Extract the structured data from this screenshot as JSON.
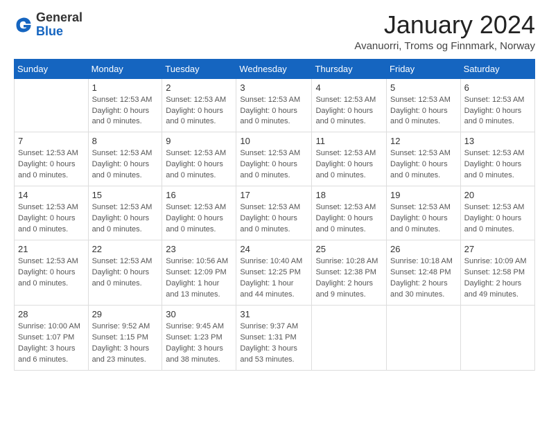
{
  "header": {
    "logo": {
      "line1": "General",
      "line2": "Blue"
    },
    "title": "January 2024",
    "subtitle": "Avanuorri, Troms og Finnmark, Norway"
  },
  "calendar": {
    "days_of_week": [
      "Sunday",
      "Monday",
      "Tuesday",
      "Wednesday",
      "Thursday",
      "Friday",
      "Saturday"
    ],
    "weeks": [
      {
        "cells": [
          {
            "day": "",
            "info": ""
          },
          {
            "day": "1",
            "info": "Sunset: 12:53 AM\nDaylight: 0 hours and 0 minutes."
          },
          {
            "day": "2",
            "info": "Sunset: 12:53 AM\nDaylight: 0 hours and 0 minutes."
          },
          {
            "day": "3",
            "info": "Sunset: 12:53 AM\nDaylight: 0 hours and 0 minutes."
          },
          {
            "day": "4",
            "info": "Sunset: 12:53 AM\nDaylight: 0 hours and 0 minutes."
          },
          {
            "day": "5",
            "info": "Sunset: 12:53 AM\nDaylight: 0 hours and 0 minutes."
          },
          {
            "day": "6",
            "info": "Sunset: 12:53 AM\nDaylight: 0 hours and 0 minutes."
          }
        ]
      },
      {
        "cells": [
          {
            "day": "7",
            "info": "Sunset: 12:53 AM\nDaylight: 0 hours and 0 minutes."
          },
          {
            "day": "8",
            "info": "Sunset: 12:53 AM\nDaylight: 0 hours and 0 minutes."
          },
          {
            "day": "9",
            "info": "Sunset: 12:53 AM\nDaylight: 0 hours and 0 minutes."
          },
          {
            "day": "10",
            "info": "Sunset: 12:53 AM\nDaylight: 0 hours and 0 minutes."
          },
          {
            "day": "11",
            "info": "Sunset: 12:53 AM\nDaylight: 0 hours and 0 minutes."
          },
          {
            "day": "12",
            "info": "Sunset: 12:53 AM\nDaylight: 0 hours and 0 minutes."
          },
          {
            "day": "13",
            "info": "Sunset: 12:53 AM\nDaylight: 0 hours and 0 minutes."
          }
        ]
      },
      {
        "cells": [
          {
            "day": "14",
            "info": "Sunset: 12:53 AM\nDaylight: 0 hours and 0 minutes."
          },
          {
            "day": "15",
            "info": "Sunset: 12:53 AM\nDaylight: 0 hours and 0 minutes."
          },
          {
            "day": "16",
            "info": "Sunset: 12:53 AM\nDaylight: 0 hours and 0 minutes."
          },
          {
            "day": "17",
            "info": "Sunset: 12:53 AM\nDaylight: 0 hours and 0 minutes."
          },
          {
            "day": "18",
            "info": "Sunset: 12:53 AM\nDaylight: 0 hours and 0 minutes."
          },
          {
            "day": "19",
            "info": "Sunset: 12:53 AM\nDaylight: 0 hours and 0 minutes."
          },
          {
            "day": "20",
            "info": "Sunset: 12:53 AM\nDaylight: 0 hours and 0 minutes."
          }
        ]
      },
      {
        "cells": [
          {
            "day": "21",
            "info": "Sunset: 12:53 AM\nDaylight: 0 hours and 0 minutes."
          },
          {
            "day": "22",
            "info": "Sunset: 12:53 AM\nDaylight: 0 hours and 0 minutes."
          },
          {
            "day": "23",
            "info": "Sunrise: 10:56 AM\nSunset: 12:09 PM\nDaylight: 1 hour and 13 minutes."
          },
          {
            "day": "24",
            "info": "Sunrise: 10:40 AM\nSunset: 12:25 PM\nDaylight: 1 hour and 44 minutes."
          },
          {
            "day": "25",
            "info": "Sunrise: 10:28 AM\nSunset: 12:38 PM\nDaylight: 2 hours and 9 minutes."
          },
          {
            "day": "26",
            "info": "Sunrise: 10:18 AM\nSunset: 12:48 PM\nDaylight: 2 hours and 30 minutes."
          },
          {
            "day": "27",
            "info": "Sunrise: 10:09 AM\nSunset: 12:58 PM\nDaylight: 2 hours and 49 minutes."
          }
        ]
      },
      {
        "cells": [
          {
            "day": "28",
            "info": "Sunrise: 10:00 AM\nSunset: 1:07 PM\nDaylight: 3 hours and 6 minutes."
          },
          {
            "day": "29",
            "info": "Sunrise: 9:52 AM\nSunset: 1:15 PM\nDaylight: 3 hours and 23 minutes."
          },
          {
            "day": "30",
            "info": "Sunrise: 9:45 AM\nSunset: 1:23 PM\nDaylight: 3 hours and 38 minutes."
          },
          {
            "day": "31",
            "info": "Sunrise: 9:37 AM\nSunset: 1:31 PM\nDaylight: 3 hours and 53 minutes."
          },
          {
            "day": "",
            "info": ""
          },
          {
            "day": "",
            "info": ""
          },
          {
            "day": "",
            "info": ""
          }
        ]
      }
    ]
  }
}
